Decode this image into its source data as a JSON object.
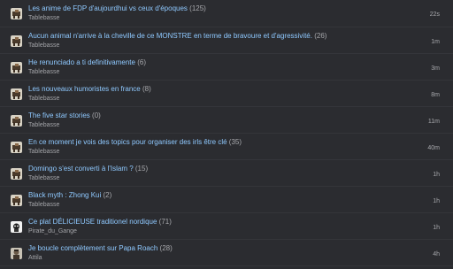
{
  "topics": [
    {
      "title": "Les anime de FDP d'aujourdhui vs ceux d'époques",
      "count": "(125)",
      "author": "Tablebasse",
      "time": "22s",
      "avatar": "tablebasse-avatar-icon"
    },
    {
      "title": "Aucun animal n'arrive à la cheville de ce MONSTRE en terme de bravoure et d'agressivité.",
      "count": "(26)",
      "author": "Tablebasse",
      "time": "1m",
      "avatar": "tablebasse-avatar-icon"
    },
    {
      "title": "He renunciado a ti definitivamente",
      "count": "(6)",
      "author": "Tablebasse",
      "time": "3m",
      "avatar": "tablebasse-avatar-icon"
    },
    {
      "title": "Les nouveaux humoristes en france",
      "count": "(8)",
      "author": "Tablebasse",
      "time": "8m",
      "avatar": "tablebasse-avatar-icon"
    },
    {
      "title": "The five star stories",
      "count": "(0)",
      "author": "Tablebasse",
      "time": "11m",
      "avatar": "tablebasse-avatar-icon"
    },
    {
      "title": "En ce moment je vois des topics pour organiser des irls être clé",
      "count": "(35)",
      "author": "Tablebasse",
      "time": "40m",
      "avatar": "tablebasse-avatar-icon"
    },
    {
      "title": "Domingo s'est converti à l'Islam ?",
      "count": "(15)",
      "author": "Tablebasse",
      "time": "1h",
      "avatar": "tablebasse-avatar-icon"
    },
    {
      "title": "Black myth : Zhong Kui",
      "count": "(2)",
      "author": "Tablebasse",
      "time": "1h",
      "avatar": "tablebasse-avatar-icon"
    },
    {
      "title": "Ce plat DÉLICIEUSE traditionel nordique",
      "count": "(71)",
      "author": "Pirate_du_Gange",
      "time": "1h",
      "avatar": "pirate-avatar-icon"
    },
    {
      "title": "Je boucle complètement sur Papa Roach",
      "count": "(28)",
      "author": "Attila",
      "time": "4h",
      "avatar": "attila-avatar-icon"
    }
  ],
  "colors": {
    "background": "#2b2c30",
    "title_link": "#8fc9ff",
    "meta_text": "#a3a4a8",
    "divider": "#34353a"
  }
}
